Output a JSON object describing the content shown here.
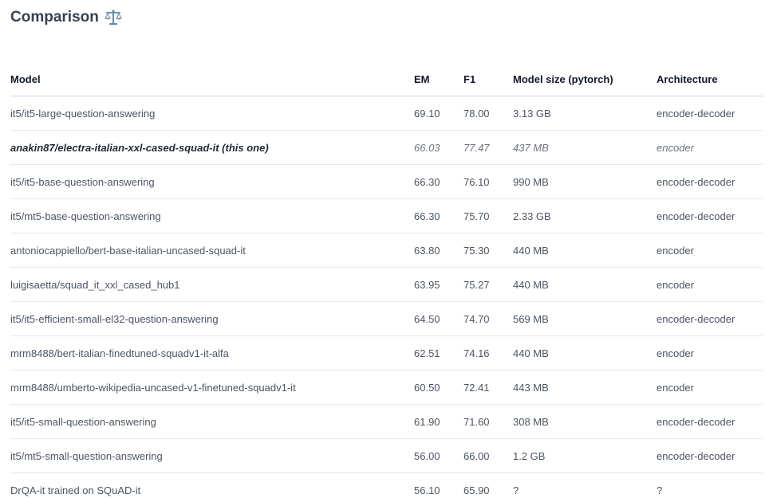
{
  "heading": {
    "title": "Comparison",
    "icon": "balance-scale-icon"
  },
  "table": {
    "columns": [
      "Model",
      "EM",
      "F1",
      "Model size (pytorch)",
      "Architecture"
    ],
    "rows": [
      {
        "model": "it5/it5-large-question-answering",
        "em": "69.10",
        "f1": "78.00",
        "size": "3.13 GB",
        "arch": "encoder-decoder",
        "highlight": false
      },
      {
        "model": "anakin87/electra-italian-xxl-cased-squad-it (this one)",
        "em": "66.03",
        "f1": "77.47",
        "size": "437 MB",
        "arch": "encoder",
        "highlight": true
      },
      {
        "model": "it5/it5-base-question-answering",
        "em": "66.30",
        "f1": "76.10",
        "size": "990 MB",
        "arch": "encoder-decoder",
        "highlight": false
      },
      {
        "model": "it5/mt5-base-question-answering",
        "em": "66.30",
        "f1": "75.70",
        "size": "2.33 GB",
        "arch": "encoder-decoder",
        "highlight": false
      },
      {
        "model": "antoniocappiello/bert-base-italian-uncased-squad-it",
        "em": "63.80",
        "f1": "75.30",
        "size": "440 MB",
        "arch": "encoder",
        "highlight": false
      },
      {
        "model": "luigisaetta/squad_it_xxl_cased_hub1",
        "em": "63.95",
        "f1": "75.27",
        "size": "440 MB",
        "arch": "encoder",
        "highlight": false
      },
      {
        "model": "it5/it5-efficient-small-el32-question-answering",
        "em": "64.50",
        "f1": "74.70",
        "size": "569 MB",
        "arch": "encoder-decoder",
        "highlight": false
      },
      {
        "model": "mrm8488/bert-italian-finedtuned-squadv1-it-alfa",
        "em": "62.51",
        "f1": "74.16",
        "size": "440 MB",
        "arch": "encoder",
        "highlight": false
      },
      {
        "model": "mrm8488/umberto-wikipedia-uncased-v1-finetuned-squadv1-it",
        "em": "60.50",
        "f1": "72.41",
        "size": "443 MB",
        "arch": "encoder",
        "highlight": false
      },
      {
        "model": "it5/it5-small-question-answering",
        "em": "61.90",
        "f1": "71.60",
        "size": "308 MB",
        "arch": "encoder-decoder",
        "highlight": false
      },
      {
        "model": "it5/mt5-small-question-answering",
        "em": "56.00",
        "f1": "66.00",
        "size": "1.2 GB",
        "arch": "encoder-decoder",
        "highlight": false
      },
      {
        "model": "DrQA-it trained on SQuAD-it",
        "em": "56.10",
        "f1": "65.90",
        "size": "?",
        "arch": "?",
        "highlight": false
      }
    ]
  }
}
